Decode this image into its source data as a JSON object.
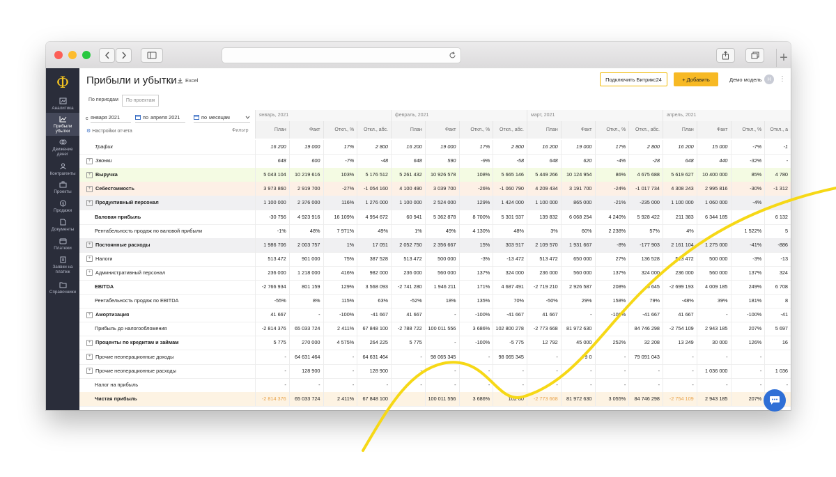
{
  "app": {
    "title": "Прибыли и убытки",
    "excel_label": "Excel",
    "connect_button": "Подключить Битрикс24",
    "add_button": "+ Добавить",
    "user_name": "Демо модель",
    "avatar_letter": "Н"
  },
  "sidebar": {
    "logo": "Ф",
    "items": [
      {
        "label": "Аналитика",
        "icon": "analytics-icon"
      },
      {
        "label": "Прибыли убытки",
        "icon": "profit-chart-icon",
        "active": true
      },
      {
        "label": "Движение денег",
        "icon": "cashflow-icon"
      },
      {
        "label": "Контрагенты",
        "icon": "contractors-icon"
      },
      {
        "label": "Проекты",
        "icon": "projects-icon"
      },
      {
        "label": "Продажи",
        "icon": "sales-icon"
      },
      {
        "label": "Документы",
        "icon": "documents-icon"
      },
      {
        "label": "Платежи",
        "icon": "payments-icon"
      },
      {
        "label": "Заявки на платеж",
        "icon": "payment-requests-icon"
      },
      {
        "label": "Справочники",
        "icon": "directories-icon"
      }
    ]
  },
  "tabs": {
    "by_period": "По периодам",
    "by_project": "По проектам"
  },
  "filters": {
    "from_label": "с",
    "from_value": "января 2021",
    "to_prefix": "по",
    "to_value": "апреля 2021",
    "step_prefix": "по",
    "step_value": "месяцам",
    "settings": "Настройки отчета",
    "filter": "Фильтр"
  },
  "months": [
    "январь, 2021",
    "февраль, 2021",
    "март, 2021",
    "апрель, 2021"
  ],
  "columns": [
    "План",
    "Факт",
    "Откл., %",
    "Откл., абс."
  ],
  "last_column_label": "Откл., а",
  "rows": [
    {
      "label": "Трафик",
      "style": "italic",
      "expand": false,
      "cells": [
        "16 200",
        "19 000",
        "17%",
        "2 800",
        "16 200",
        "19 000",
        "17%",
        "2 800",
        "16 200",
        "19 000",
        "17%",
        "2 800",
        "16 200",
        "15 000",
        "-7%",
        "-1"
      ]
    },
    {
      "label": "Звонки",
      "style": "italic",
      "expand": true,
      "cells": [
        "648",
        "600",
        "-7%",
        "-48",
        "648",
        "590",
        "-9%",
        "-58",
        "648",
        "620",
        "-4%",
        "-28",
        "648",
        "440",
        "-32%",
        "-"
      ]
    },
    {
      "label": "Выручка",
      "style": "bold",
      "expand": true,
      "bg": "#f4fbe3",
      "cells": [
        "5 043 104",
        "10 219 616",
        "103%",
        "5 176 512",
        "5 261 432",
        "10 926 578",
        "108%",
        "5 665 146",
        "5 449 266",
        "10 124 954",
        "86%",
        "4 675 688",
        "5 619 627",
        "10 400 000",
        "85%",
        "4 780"
      ]
    },
    {
      "label": "Себестоимость",
      "style": "bold",
      "expand": true,
      "bg": "#fdf0e6",
      "cells": [
        "3 973 860",
        "2 919 700",
        "-27%",
        "-1 054 160",
        "4 100 490",
        "3 039 700",
        "-26%",
        "-1 060 790",
        "4 209 434",
        "3 191 700",
        "-24%",
        "-1 017 734",
        "4 308 243",
        "2 995 816",
        "-30%",
        "-1 312"
      ]
    },
    {
      "label": "Продуктивный персонал",
      "style": "bold",
      "expand": true,
      "bg": "#f0f0f2",
      "cells": [
        "1 100 000",
        "2 376 000",
        "116%",
        "1 276 000",
        "1 100 000",
        "2 524 000",
        "129%",
        "1 424 000",
        "1 100 000",
        "865 000",
        "-21%",
        "-235 000",
        "1 100 000",
        "1 060 000",
        "-4%",
        "-"
      ]
    },
    {
      "label": "Валовая прибыль",
      "style": "bold",
      "expand": false,
      "cells": [
        "-30 756",
        "4 923 916",
        "16 109%",
        "4 954 672",
        "60 941",
        "5 362 878",
        "8 700%",
        "5 301 937",
        "139 832",
        "6 068 254",
        "4 240%",
        "5 928 422",
        "211 383",
        "6 344 185",
        "",
        "6 132"
      ]
    },
    {
      "label": "Рентабельность продаж по валовой прибыли",
      "style": "normal",
      "expand": false,
      "cells": [
        "-1%",
        "48%",
        "7 971%",
        "49%",
        "1%",
        "49%",
        "4 130%",
        "48%",
        "3%",
        "60%",
        "2 238%",
        "57%",
        "4%",
        "",
        "1 522%",
        "5"
      ]
    },
    {
      "label": "Постоянные расходы",
      "style": "bold",
      "expand": true,
      "bg": "#f0f0f2",
      "cells": [
        "1 986 706",
        "2 003 757",
        "1%",
        "17 051",
        "2 052 750",
        "2 356 667",
        "15%",
        "303 917",
        "2 109 570",
        "1 931 667",
        "-8%",
        "-177 903",
        "2 161 104",
        "1 275 000",
        "-41%",
        "-886"
      ]
    },
    {
      "label": "Налоги",
      "style": "normal",
      "expand": true,
      "cells": [
        "513 472",
        "901 000",
        "75%",
        "387 528",
        "513 472",
        "500 000",
        "-3%",
        "-13 472",
        "513 472",
        "650 000",
        "27%",
        "136 528",
        "513 472",
        "500 000",
        "-3%",
        "-13"
      ]
    },
    {
      "label": "Административный персонал",
      "style": "normal",
      "expand": true,
      "cells": [
        "236 000",
        "1 218 000",
        "416%",
        "982 000",
        "236 000",
        "560 000",
        "137%",
        "324 000",
        "236 000",
        "560 000",
        "137%",
        "324 000",
        "236 000",
        "560 000",
        "137%",
        "324"
      ]
    },
    {
      "label": "EBITDA",
      "style": "bold",
      "expand": false,
      "cells": [
        "-2 766 934",
        "801 159",
        "129%",
        "3 568 093",
        "-2 741 280",
        "1 946 211",
        "171%",
        "4 687 491",
        "-2 719 210",
        "2 926 587",
        "208%",
        "5 645",
        "-2 699 193",
        "4 009 185",
        "249%",
        "6 708"
      ]
    },
    {
      "label": "Рентабельность продаж по EBITDA",
      "style": "normal",
      "expand": false,
      "cells": [
        "-55%",
        "8%",
        "115%",
        "63%",
        "-52%",
        "18%",
        "135%",
        "70%",
        "-50%",
        "29%",
        "158%",
        "79%",
        "-48%",
        "39%",
        "181%",
        "8"
      ]
    },
    {
      "label": "Амортизация",
      "style": "bold",
      "expand": true,
      "cells": [
        "41 667",
        "-",
        "-100%",
        "-41 667",
        "41 667",
        "-",
        "-100%",
        "-41 667",
        "41 667",
        "-",
        "-100%",
        "-41 667",
        "41 667",
        "-",
        "-100%",
        "-41"
      ]
    },
    {
      "label": "Прибыль до налогообложения",
      "style": "normal",
      "expand": false,
      "cells": [
        "-2 814 376",
        "65 033 724",
        "2 411%",
        "67 848 100",
        "-2 788 722",
        "100 011 556",
        "3 686%",
        "102 800 278",
        "-2 773 668",
        "81 972 630",
        "",
        "84 746 298",
        "-2 754 109",
        "2 943 185",
        "207%",
        "5 697"
      ]
    },
    {
      "label": "Проценты по кредитам и займам",
      "style": "bold",
      "expand": true,
      "cells": [
        "5 775",
        "270 000",
        "4 575%",
        "264 225",
        "5 775",
        "-",
        "-100%",
        "-5 775",
        "12 792",
        "45 000",
        "252%",
        "32 208",
        "13 249",
        "30 000",
        "126%",
        "16"
      ]
    },
    {
      "label": "Прочие неоперационные доходы",
      "style": "normal",
      "expand": true,
      "cells": [
        "-",
        "64 631 464",
        "-",
        "64 631 464",
        "-",
        "98 065 345",
        "-",
        "98 065 345",
        "-",
        "79 0",
        "-",
        "79 091 043",
        "-",
        "-",
        "-",
        ""
      ]
    },
    {
      "label": "Прочие неоперационные расходы",
      "style": "normal",
      "expand": true,
      "cells": [
        "-",
        "128 900",
        "-",
        "128 900",
        "-",
        "-",
        "-",
        "-",
        "-",
        "-",
        "-",
        "-",
        "-",
        "1 036 000",
        "-",
        "1 036"
      ]
    },
    {
      "label": "Налог на прибыль",
      "style": "normal",
      "expand": false,
      "cells": [
        "-",
        "-",
        "-",
        "-",
        "-",
        "-",
        "-",
        "-",
        "-",
        "-",
        "-",
        "-",
        "-",
        "-",
        "-",
        "-"
      ]
    },
    {
      "label": "Чистая прибыль",
      "style": "bold",
      "expand": false,
      "bg": "#fdf3e3",
      "cells": [
        "-2 814 376",
        "65 033 724",
        "2 411%",
        "67 848 100",
        "",
        "100 011 556",
        "3 686%",
        "102 80",
        "-2 773 668",
        "81 972 630",
        "3 055%",
        "84 746 298",
        "-2 754 109",
        "2 943 185",
        "207%",
        ""
      ],
      "negative_color": "#e8a24a"
    }
  ],
  "colors": {
    "sidebar": "#2a2d3a",
    "accent": "#f7b924",
    "curve": "#f6d816",
    "chat": "#2f6fd6"
  }
}
